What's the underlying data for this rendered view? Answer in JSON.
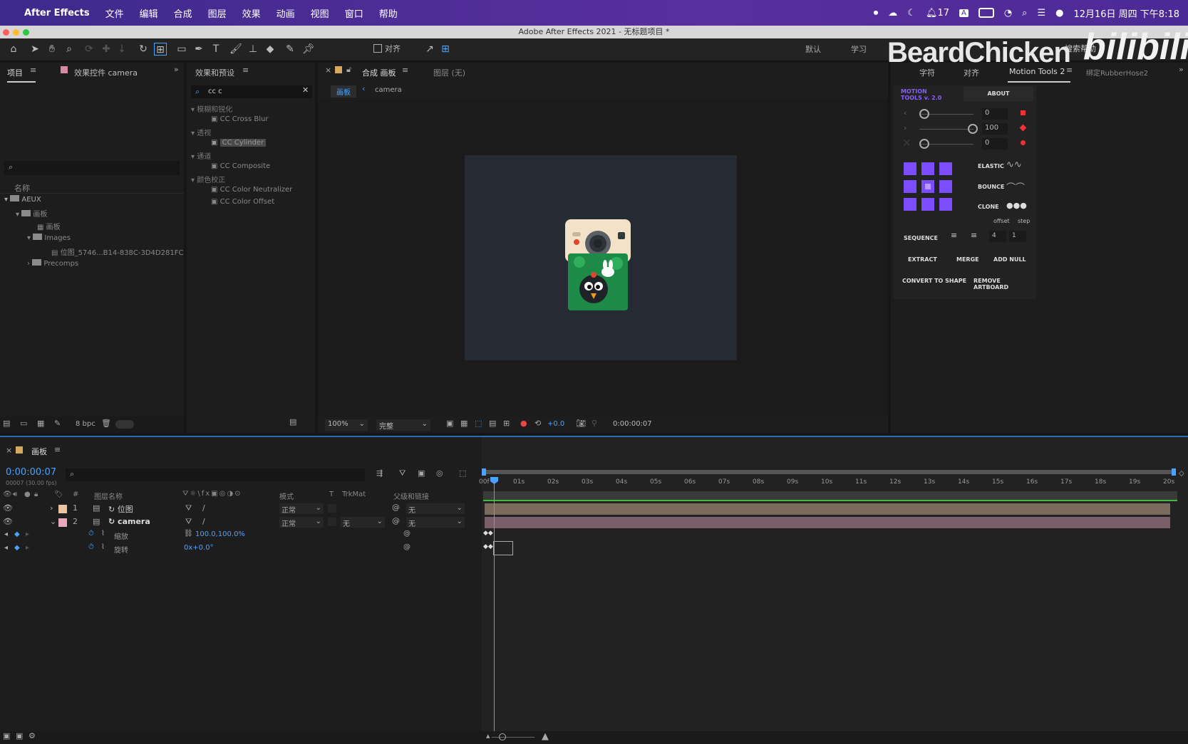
{
  "menubar": {
    "app": "After Effects",
    "items": [
      "文件",
      "编辑",
      "合成",
      "图层",
      "效果",
      "动画",
      "视图",
      "窗口",
      "帮助"
    ],
    "notif_count": "17",
    "clock": "12月16日 周四 下午8:18"
  },
  "window": {
    "title": "Adobe After Effects 2021 - 无标题项目 *"
  },
  "toolbar": {
    "snap_label": "对齐",
    "workspaces": [
      "默认",
      "学习"
    ]
  },
  "watermark": {
    "brand": "BeardChicken",
    "site": "bilibili",
    "search": "搜索帮助"
  },
  "project_panel": {
    "tab_project": "项目",
    "tab_effect_controls": "效果控件 camera",
    "col_name": "名称",
    "bpc": "8 bpc",
    "tree": [
      {
        "label": "AEUX"
      },
      {
        "label": "画板"
      },
      {
        "label": "画板"
      },
      {
        "label": "Images"
      },
      {
        "label": "位图_5746...B14-838C-3D4D281FC"
      },
      {
        "label": "Precomps"
      }
    ]
  },
  "effects_panel": {
    "tab": "效果和预设",
    "search_value": "cc c",
    "items": [
      {
        "label": "模糊和锐化"
      },
      {
        "label": "CC Cross Blur"
      },
      {
        "label": "透视"
      },
      {
        "label": "CC Cylinder"
      },
      {
        "label": "通道"
      },
      {
        "label": "CC Composite"
      },
      {
        "label": "颜色校正"
      },
      {
        "label": "CC Color Neutralizer"
      },
      {
        "label": "CC Color Offset"
      }
    ]
  },
  "comp_panel": {
    "tab_comp": "合成 画板",
    "tab_layer": "图层 (无)",
    "breadcrumb": [
      "画板",
      "camera"
    ],
    "zoom": "100%",
    "quality": "完整",
    "exposure": "+0.0",
    "timecode": "0:00:00:07"
  },
  "right_panel": {
    "tabs": [
      "字符",
      "对齐",
      "Motion Tools 2",
      "绑定RubberHose2"
    ],
    "logo": "MOTION TOOLS v. 2.0",
    "about": "ABOUT",
    "slider_values": [
      "0",
      "100",
      "0"
    ],
    "labels": {
      "elastic": "ELASTIC",
      "bounce": "BOUNCE",
      "clone": "CLONE",
      "offset": "offset",
      "step": "step",
      "sequence": "SEQUENCE",
      "seq_offset": "4",
      "seq_step": "1",
      "extract": "EXTRACT",
      "merge": "MERGE",
      "add_null": "ADD NULL",
      "convert": "CONVERT TO SHAPE",
      "remove": "REMOVE ARTBOARD"
    }
  },
  "timeline": {
    "tab": "画板",
    "timecode": "0:00:00:07",
    "fps": "00007 (30.00 fps)",
    "headers": {
      "num": "#",
      "layer_name": "图层名称",
      "mode": "模式",
      "t": "T",
      "trkmat": "TrkMat",
      "parent": "父级和链接"
    },
    "layers": [
      {
        "num": "1",
        "name": "位图",
        "mode": "正常",
        "trkmat": "",
        "parent": "无"
      },
      {
        "num": "2",
        "name": "camera",
        "mode": "正常",
        "trkmat": "无",
        "parent": "无"
      }
    ],
    "props": [
      {
        "name": "缩放",
        "value": "100.0,100.0%"
      },
      {
        "name": "旋转",
        "value": "0x+0.0°"
      }
    ],
    "ruler": [
      "00f",
      "01s",
      "02s",
      "03s",
      "04s",
      "05s",
      "06s",
      "07s",
      "08s",
      "09s",
      "10s",
      "11s",
      "12s",
      "13s",
      "14s",
      "15s",
      "16s",
      "17s",
      "18s",
      "19s",
      "20s"
    ]
  }
}
